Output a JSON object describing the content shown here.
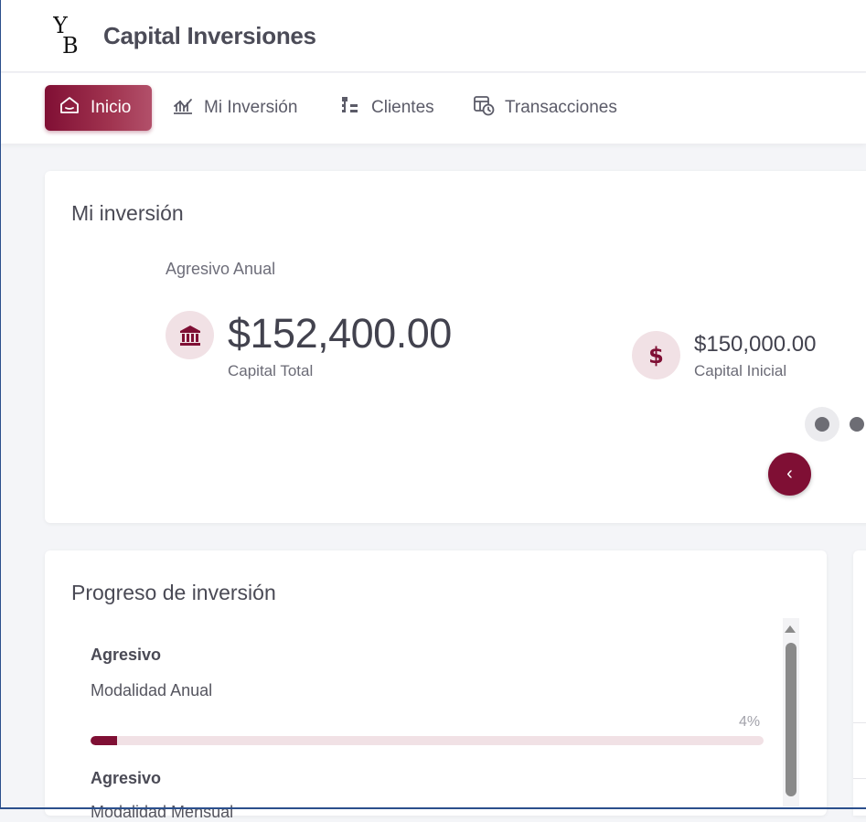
{
  "header": {
    "logo_text": "YB",
    "app_title": "Capital Inversiones"
  },
  "nav": {
    "items": [
      {
        "label": "Inicio",
        "icon": "home-icon",
        "active": true
      },
      {
        "label": "Mi Inversión",
        "icon": "chart-trend-icon",
        "active": false
      },
      {
        "label": "Clientes",
        "icon": "hierarchy-icon",
        "active": false
      },
      {
        "label": "Transacciones",
        "icon": "calendar-clock-icon",
        "active": false
      }
    ]
  },
  "investment_card": {
    "title": "Mi inversión",
    "plan_name": "Agresivo Anual",
    "capital_total": {
      "value": "$152,400.00",
      "label": "Capital Total",
      "icon": "bank-icon"
    },
    "capital_inicial": {
      "value": "$150,000.00",
      "label": "Capital Inicial",
      "icon": "dollar-icon"
    },
    "carousel": {
      "prev_label": "‹",
      "active_index": 0
    }
  },
  "progress_card": {
    "title": "Progreso de inversión",
    "items": [
      {
        "name": "Agresivo",
        "modality": "Modalidad Anual",
        "percent_label": "4%",
        "percent": 4
      },
      {
        "name": "Agresivo",
        "modality": "Modalidad Mensual"
      }
    ]
  },
  "colors": {
    "brand": "#7f0f34",
    "brand_light": "#f1e1e5",
    "background": "#f4f5f8"
  }
}
